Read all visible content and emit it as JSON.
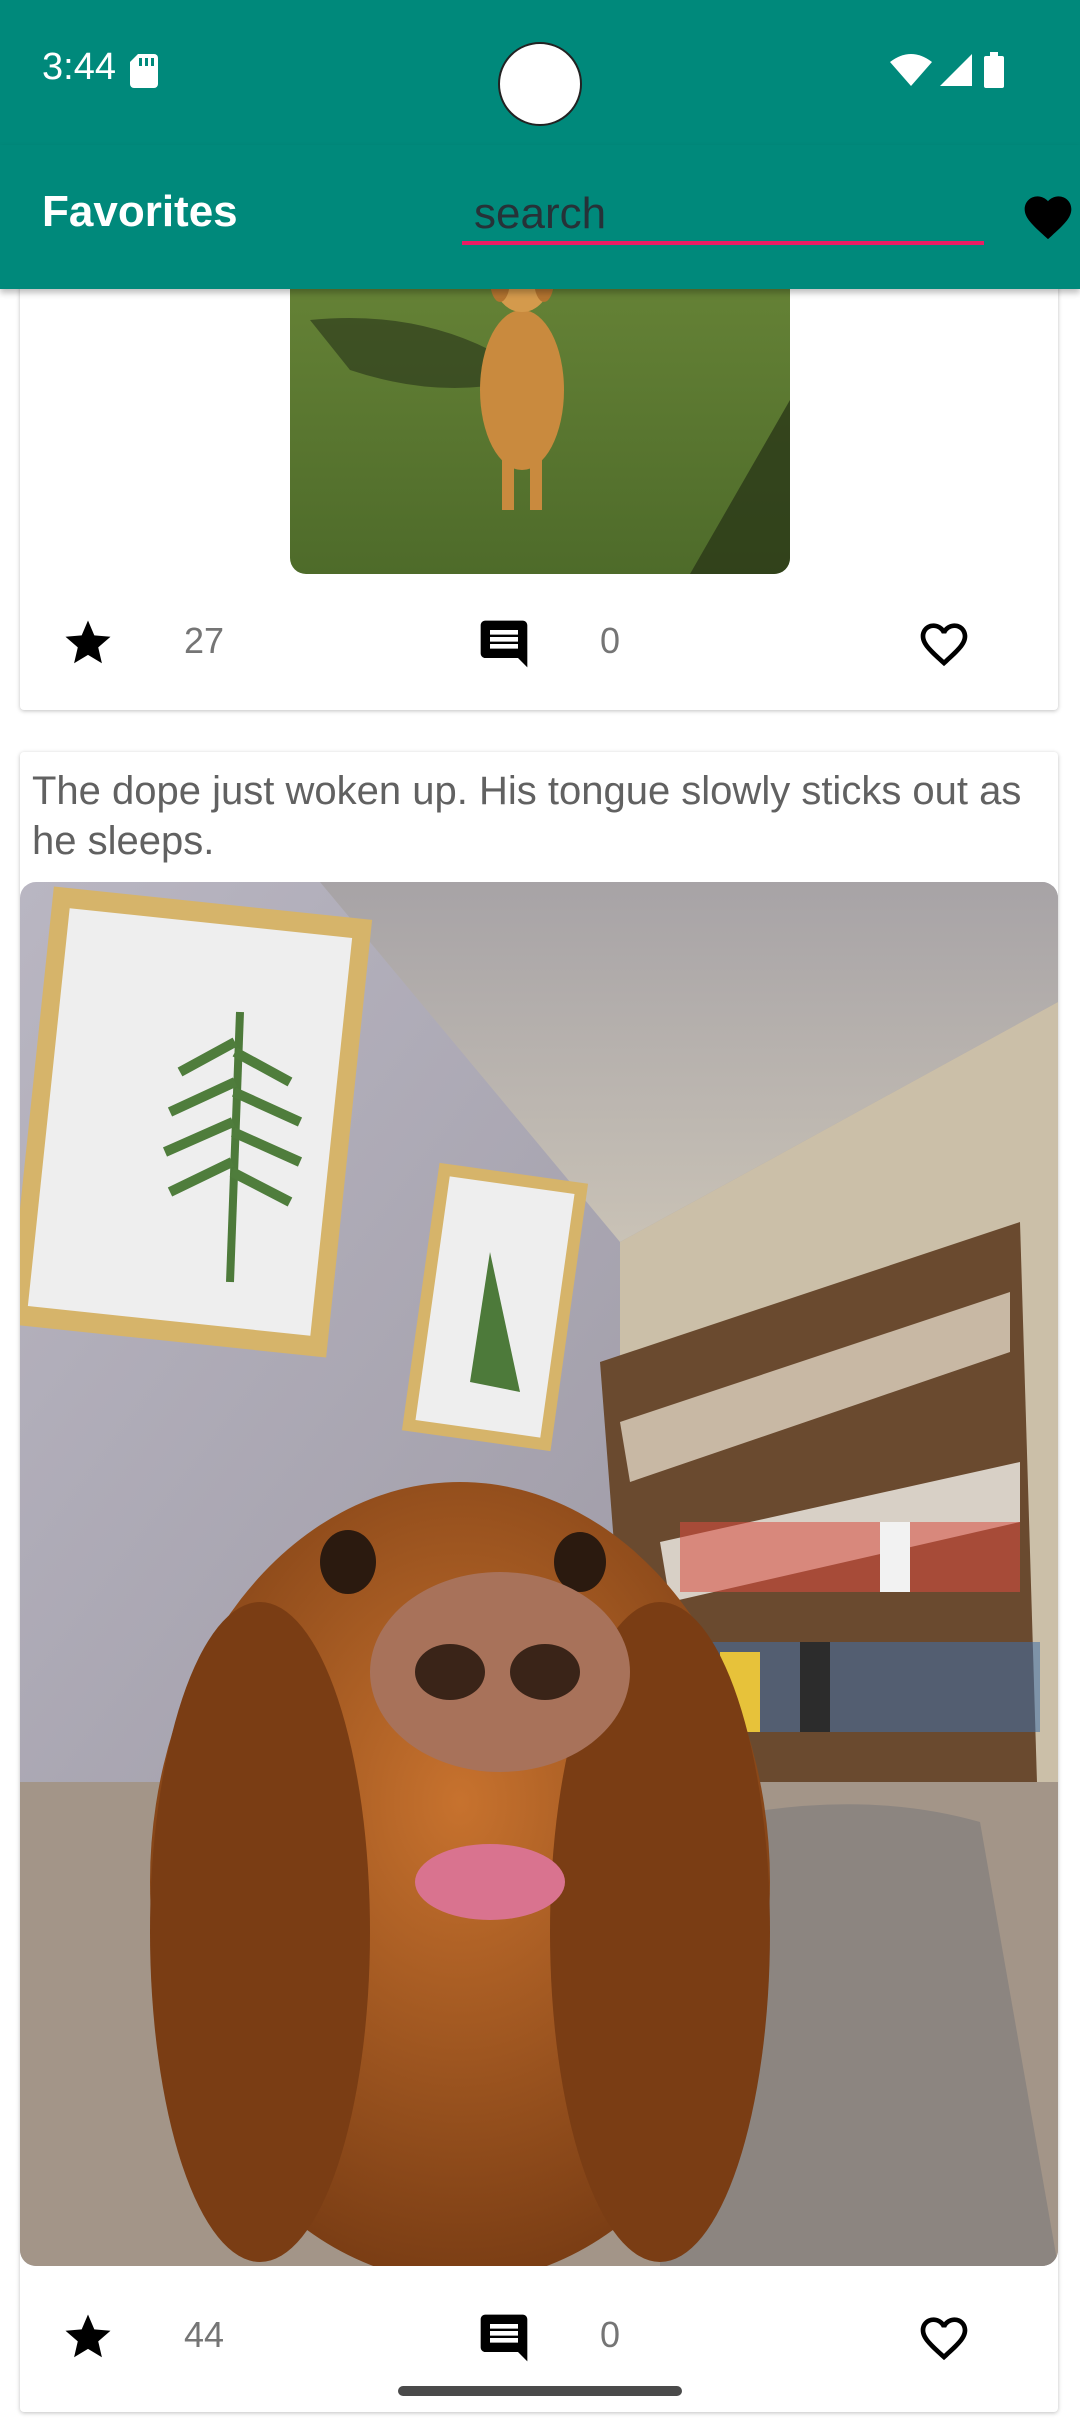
{
  "status_bar": {
    "time": "3:44",
    "icons": [
      "sd-card-icon",
      "wifi-icon",
      "signal-icon",
      "battery-icon"
    ]
  },
  "app_bar": {
    "title": "Favorites",
    "search": {
      "value": "",
      "placeholder": "search"
    },
    "heart_icon": "heart-filled-icon"
  },
  "colors": {
    "primary": "#00897b",
    "accent": "#e91e63",
    "text_secondary": "#757575",
    "caption": "#616161"
  },
  "posts": [
    {
      "caption": "",
      "image": "golden-retriever-sitting-on-grass",
      "rating_count": "27",
      "comment_count": "0"
    },
    {
      "caption": "The dope just woken up. His tongue slowly sticks out as he sleeps.",
      "image": "spaniel-closeup-living-room",
      "rating_count": "44",
      "comment_count": "0"
    }
  ]
}
